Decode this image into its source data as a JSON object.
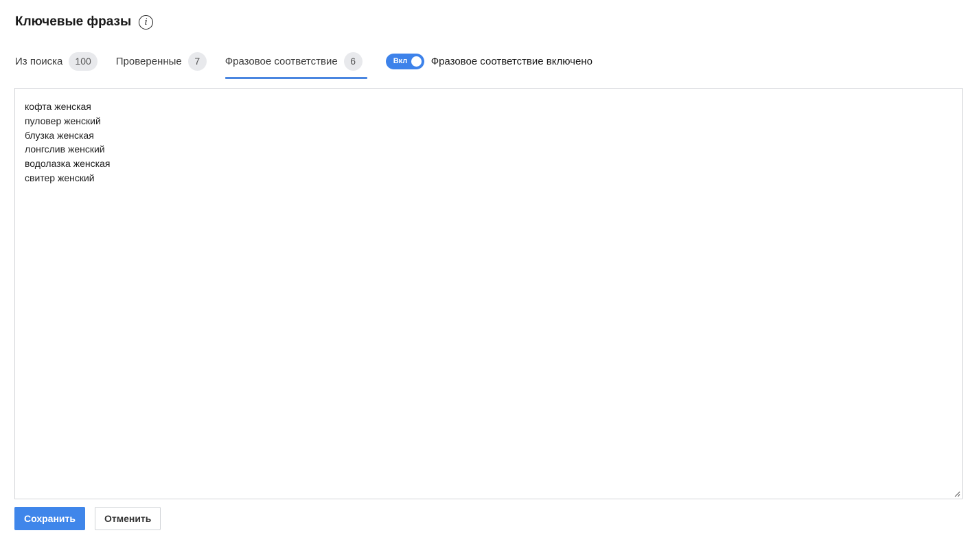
{
  "header": {
    "title": "Ключевые фразы",
    "info_icon_glyph": "i",
    "info_icon": "info-icon"
  },
  "tabs": [
    {
      "label": "Из поиска",
      "count": "100",
      "active": false
    },
    {
      "label": "Проверенные",
      "count": "7",
      "active": false
    },
    {
      "label": "Фразовое соответствие",
      "count": "6",
      "active": true
    }
  ],
  "toggle": {
    "state_label": "Вкл",
    "enabled": true,
    "description": "Фразовое соответствие включено"
  },
  "editor": {
    "lines": [
      "кофта женская",
      "пуловер женский",
      "блузка женская",
      "лонгслив женский",
      "водолазка женская",
      "свитер женский"
    ]
  },
  "actions": {
    "save_label": "Сохранить",
    "cancel_label": "Отменить"
  },
  "colors": {
    "accent": "#3f86ea",
    "tab_underline": "#4a86e0",
    "badge_bg": "#e8e9ec",
    "border": "#d3d5d9"
  }
}
